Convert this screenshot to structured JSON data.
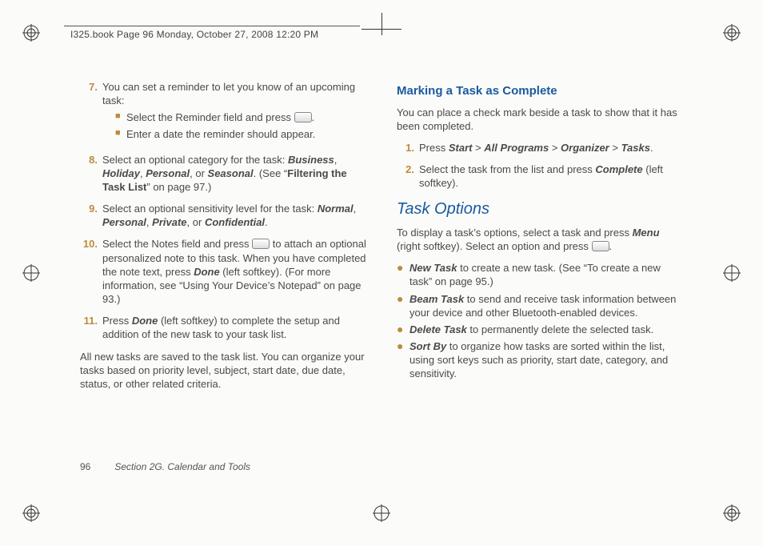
{
  "header": {
    "crop_text": "I325.book  Page 96  Monday, October 27, 2008  12:20 PM"
  },
  "left": {
    "item7": {
      "num": "7.",
      "text": "You can set a reminder to let you know of an upcoming task:",
      "sub1_a": "Select the Reminder field and press ",
      "sub1_b": ".",
      "sub2": "Enter a date the reminder should appear."
    },
    "item8": {
      "num": "8.",
      "a": "Select an optional category for the task: ",
      "b_business": "Business",
      "c": ", ",
      "b_holiday": "Holiday",
      "e": ", ",
      "b_personal": "Personal",
      "g": ", or ",
      "b_seasonal": "Seasonal",
      "i": ". (See “",
      "b_filter": "Filtering the Task List",
      "k": "” on page 97.)"
    },
    "item9": {
      "num": "9.",
      "a": "Select an optional sensitivity level for the task: ",
      "b_normal": "Normal",
      "c": ", ",
      "b_personal": "Personal",
      "e": ", ",
      "b_private": "Private",
      "g": ", or ",
      "b_conf": "Confidential",
      "i": "."
    },
    "item10": {
      "num": "10.",
      "a": "Select the Notes field and press ",
      "b": " to attach an optional personalized note to this task. When you have completed the note text, press ",
      "b_done": "Done",
      "d": " (left softkey). (For more information, see “Using Your Device’s Notepad” on page 93.)"
    },
    "item11": {
      "num": "11.",
      "a": "Press ",
      "b_done": "Done",
      "c": " (left softkey) to complete the setup and addition of the new task to your task list."
    },
    "tail": "All new tasks are saved to the task list. You can organize your tasks based on priority level, subject, start date, due date, status, or other related criteria."
  },
  "right": {
    "h1": "Marking a Task as Complete",
    "intro": "You can place a check mark beside a task to show that it has been completed.",
    "step1": {
      "num": "1.",
      "a": "Press ",
      "b_start": "Start",
      "gt1": " > ",
      "b_all": "All Programs",
      "gt2": " > ",
      "b_org": "Organizer",
      "gt3": " > ",
      "b_tasks": "Tasks",
      "end": "."
    },
    "step2": {
      "num": "2.",
      "a": "Select the task from the list and press ",
      "b_complete": "Complete",
      "c": " (left softkey)."
    },
    "h2": "Task Options",
    "opt_intro_a": "To display a task’s options, select a task and press ",
    "opt_menu": "Menu",
    "opt_intro_b": " (right softkey). Select an option and press ",
    "opt_intro_c": ".",
    "b1": {
      "t": "New Task",
      "rest": " to create a new task. (See “To create a new task” on page 95.)"
    },
    "b2": {
      "t": "Beam Task",
      "rest": " to send and receive task information between your device and other Bluetooth-enabled devices."
    },
    "b3": {
      "t": "Delete Task",
      "rest": " to permanently delete the selected task."
    },
    "b4": {
      "t": "Sort By",
      "rest": " to organize how tasks are sorted within the list, using sort keys such as priority, start date, category, and sensitivity."
    }
  },
  "footer": {
    "page": "96",
    "section": "Section 2G. Calendar and Tools"
  }
}
